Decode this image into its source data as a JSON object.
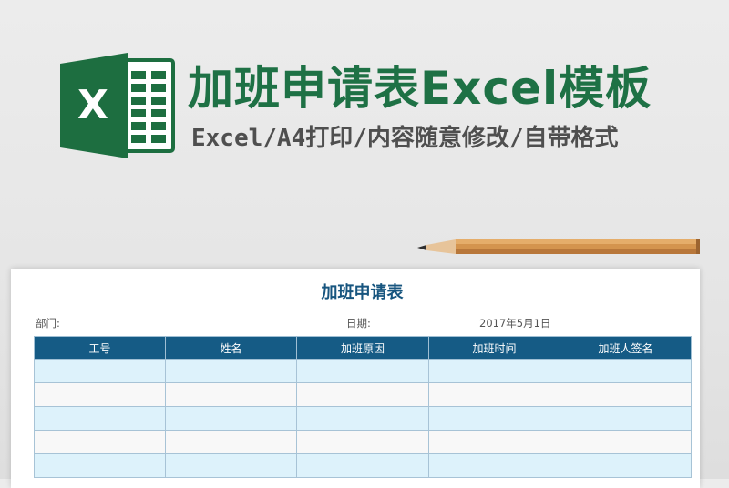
{
  "banner": {
    "title": "加班申请表Excel模板",
    "subtitle": "Excel/A4打印/内容随意修改/自带格式",
    "title_color": "#1e7145",
    "subtitle_color": "#4f4f4f"
  },
  "logo": {
    "icon": "excel-logo-icon",
    "letter": "X",
    "brand_color": "#1d6e40"
  },
  "sheet": {
    "title": "加班申请表",
    "title_color": "#17557f",
    "dept_label": "部门:",
    "date_label": "日期:",
    "date_value": "2017年5月1日",
    "columns": [
      "工号",
      "姓名",
      "加班原因",
      "加班时间",
      "加班人签名"
    ],
    "header_color": "#155b85",
    "row_colors": [
      "#ddf2fb",
      "#f8f8f8"
    ],
    "rows": [
      [
        "",
        "",
        "",
        "",
        ""
      ],
      [
        "",
        "",
        "",
        "",
        ""
      ],
      [
        "",
        "",
        "",
        "",
        ""
      ],
      [
        "",
        "",
        "",
        "",
        ""
      ],
      [
        "",
        "",
        "",
        "",
        ""
      ]
    ]
  },
  "decor": {
    "pencil_icon": "pencil-icon"
  }
}
